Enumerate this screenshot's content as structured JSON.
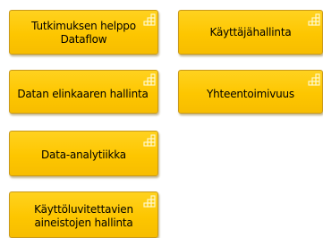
{
  "colors": {
    "box_fill": "#fdc600",
    "box_border": "#c99a1a",
    "icon_stroke": "#fff7c8"
  },
  "icon_name": "grid-chart-icon",
  "boxes": [
    {
      "label": "Tutkimuksen helppo\nDataflow"
    },
    {
      "label": "Käyttäjähallinta"
    },
    {
      "label": "Datan elinkaaren hallinta"
    },
    {
      "label": "Yhteentoimivuus"
    },
    {
      "label": "Data-analytiikka"
    },
    {
      "label": "Käyttöluvitettavien\naineistojen hallinta"
    }
  ]
}
